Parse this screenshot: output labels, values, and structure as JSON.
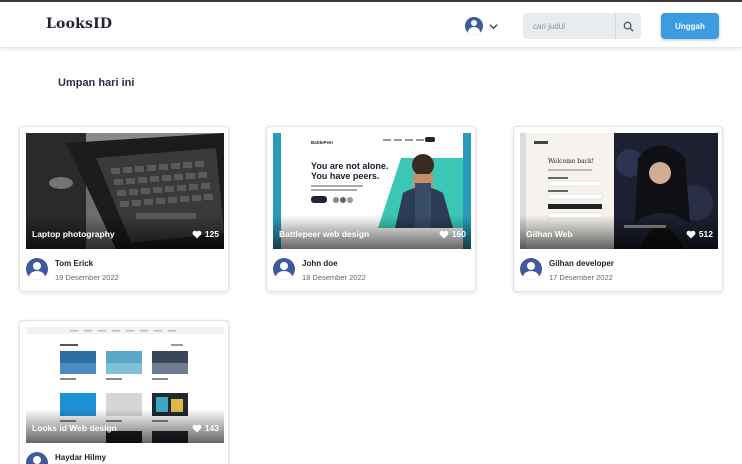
{
  "header": {
    "brand": "LooksID",
    "search_placeholder": "cari judul",
    "upload_label": "Unggah"
  },
  "icons": {
    "profile": "user-avatar-icon",
    "dropdown": "chevron-down-icon",
    "search": "search-icon",
    "like": "heart-icon"
  },
  "colors": {
    "accent": "#3d9be0",
    "avatar": "#3d5a9c"
  },
  "feed": {
    "title": "Umpan hari ini",
    "posts": [
      {
        "title": "Laptop photography",
        "likes": "125",
        "author": "Tom Erick",
        "date": "19 Desember 2022"
      },
      {
        "title": "Battlepeer web design",
        "likes": "160",
        "author": "John doe",
        "date": "18 Desember 2022"
      },
      {
        "title": "Gilhan Web",
        "likes": "512",
        "author": "Gilhan developer",
        "date": "17 Desember 2022"
      },
      {
        "title": "Looks id Web design",
        "likes": "143",
        "author": "Haydar Hilmy",
        "date": ""
      }
    ]
  },
  "thumbs": {
    "battlepeer": {
      "logo": "BattlePeer",
      "headline1": "You are not alone.",
      "headline2": "You have peers."
    },
    "gilhan": {
      "welcome": "Welcome back!"
    }
  }
}
